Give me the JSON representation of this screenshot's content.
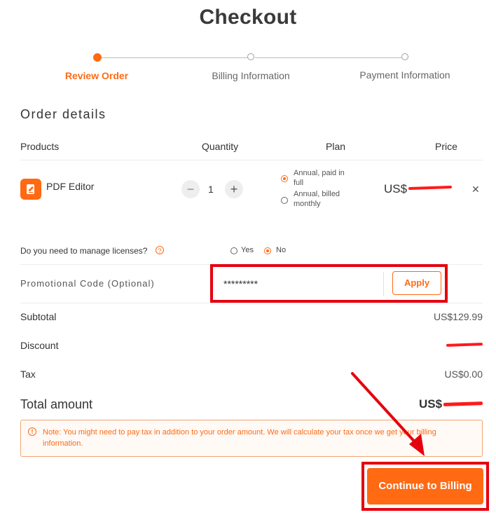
{
  "page": {
    "title": "Checkout"
  },
  "steps": [
    {
      "label": "Review Order",
      "active": true
    },
    {
      "label": "Billing Information",
      "active": false
    },
    {
      "label": "Payment Information",
      "active": false
    }
  ],
  "order": {
    "section_title": "Order details",
    "headers": {
      "products": "Products",
      "quantity": "Quantity",
      "plan": "Plan",
      "price": "Price"
    },
    "item": {
      "name": "PDF Editor",
      "icon": "pdf-editor-icon",
      "quantity": "1",
      "plan_options": [
        {
          "label": "Annual, paid in full",
          "selected": true
        },
        {
          "label": "Annual, billed monthly",
          "selected": false
        }
      ],
      "price_prefix": "US$"
    }
  },
  "licenses": {
    "question": "Do you need to manage licenses?",
    "options": [
      {
        "label": "Yes",
        "selected": false
      },
      {
        "label": "No",
        "selected": true
      }
    ]
  },
  "promo": {
    "label": "Promotional Code (Optional)",
    "value": "*********",
    "apply_label": "Apply"
  },
  "summary": {
    "subtotal_label": "Subtotal",
    "subtotal_value": "US$129.99",
    "discount_label": "Discount",
    "tax_label": "Tax",
    "tax_value": "US$0.00",
    "total_label": "Total amount",
    "total_prefix": "US$"
  },
  "note": "Note: You might need to pay tax in addition to your order amount. We will calculate your tax once we get your billing information.",
  "cta_label": "Continue to Billing",
  "colors": {
    "accent": "#ff6a13",
    "annotation_red": "#e5000d"
  }
}
